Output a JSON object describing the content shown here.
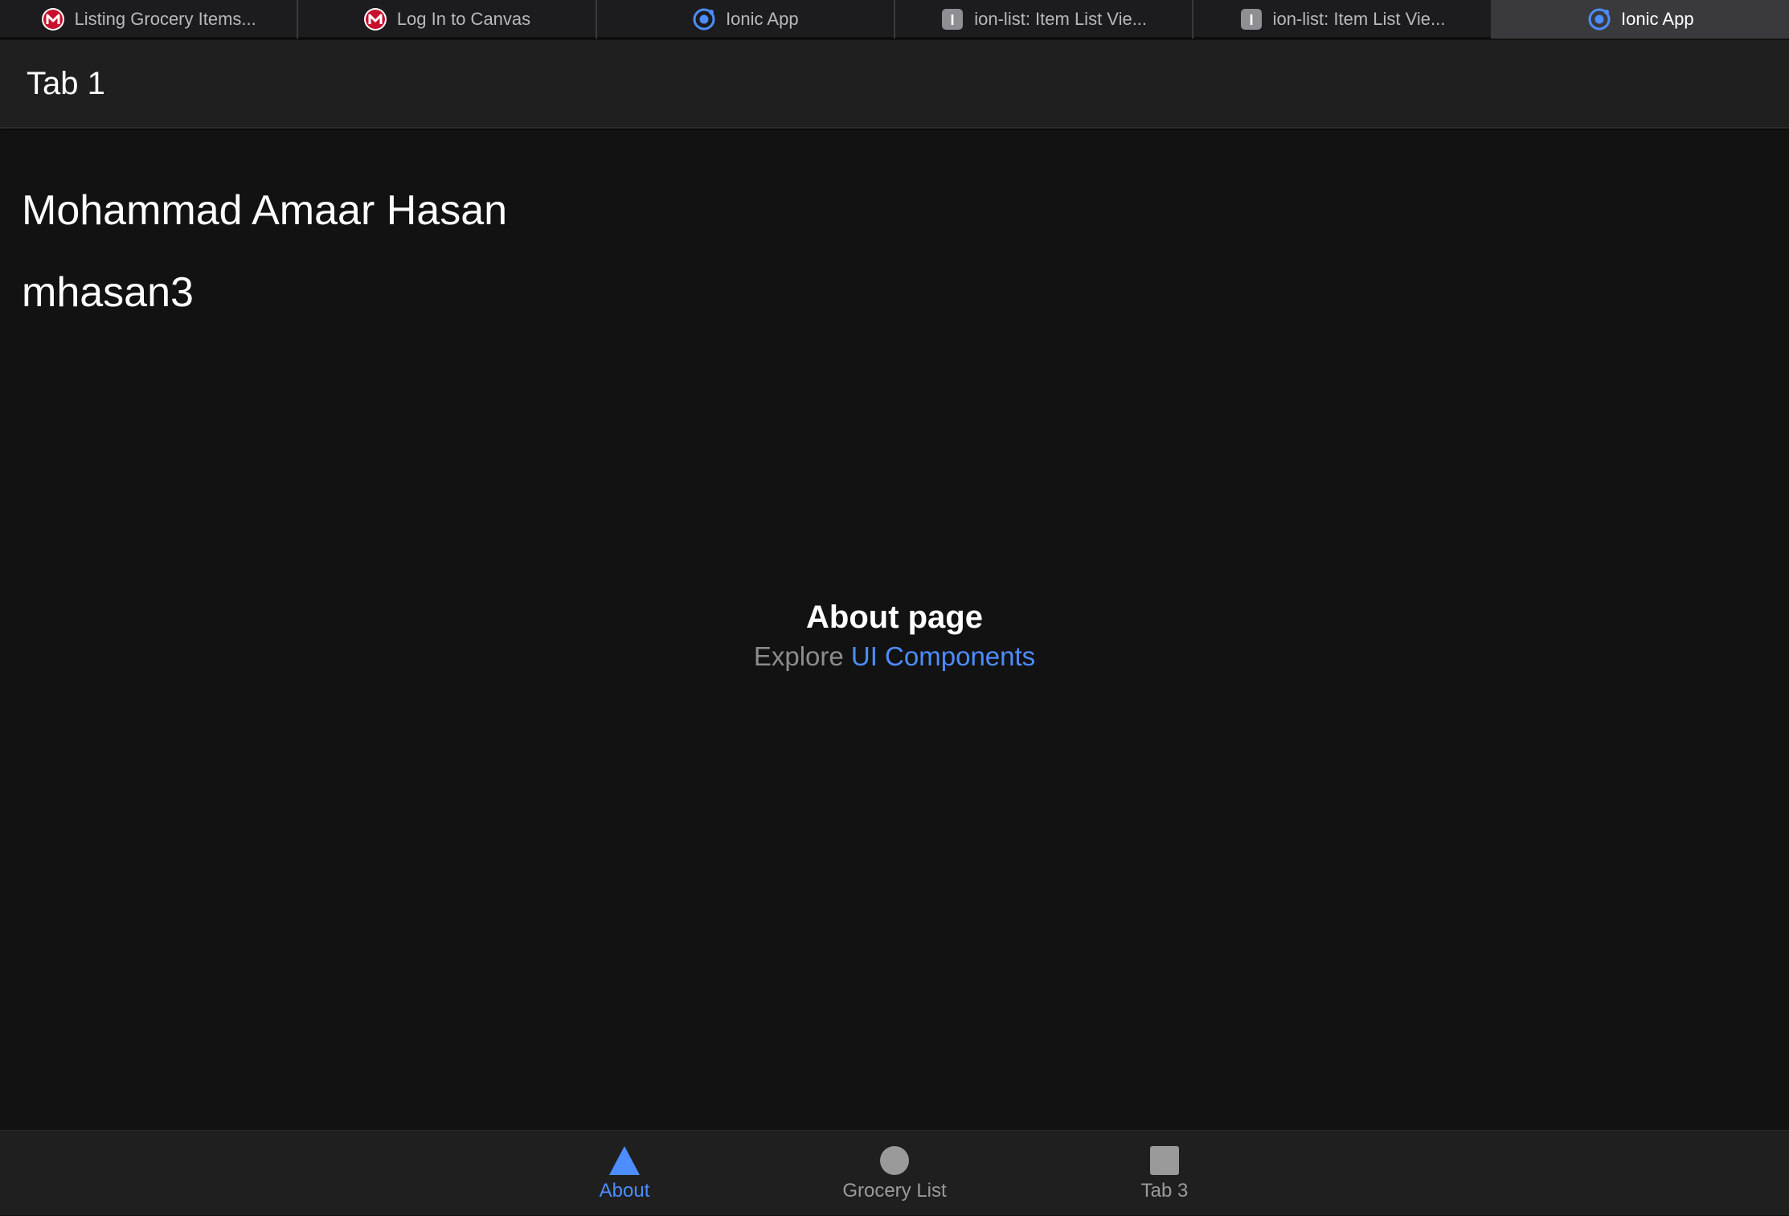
{
  "browser": {
    "tabs": [
      {
        "title": "Listing Grocery Items...",
        "icon": "canvas-m-icon",
        "active": false
      },
      {
        "title": "Log In to Canvas",
        "icon": "canvas-m-icon",
        "active": false
      },
      {
        "title": "Ionic App",
        "icon": "ionic-icon",
        "active": false
      },
      {
        "title": "ion-list: Item List Vie...",
        "icon": "ionic-docs-icon",
        "active": false
      },
      {
        "title": "ion-list: Item List Vie...",
        "icon": "ionic-docs-icon",
        "active": false
      },
      {
        "title": "Ionic App",
        "icon": "ionic-icon",
        "active": true
      }
    ],
    "docs_icon_letter": "I"
  },
  "header": {
    "title": "Tab 1"
  },
  "main": {
    "name": "Mohammad Amaar Hasan",
    "username": "mhasan3",
    "empty_state": {
      "heading": "About page",
      "explore_text": "Explore ",
      "link_text": "UI Components"
    }
  },
  "bottom_tabs": [
    {
      "label": "About",
      "icon": "triangle-icon",
      "active": true
    },
    {
      "label": "Grocery List",
      "icon": "ellipse-icon",
      "active": false
    },
    {
      "label": "Tab 3",
      "icon": "square-icon",
      "active": false
    }
  ],
  "colors": {
    "accent": "#4d8dff",
    "canvas_red": "#c8102e",
    "inactive": "#9a9a9a",
    "background": "#121212"
  }
}
